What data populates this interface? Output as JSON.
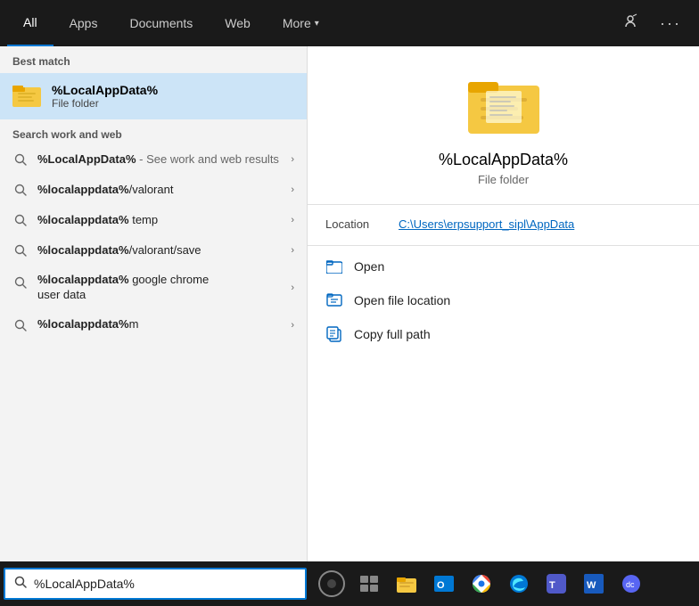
{
  "nav": {
    "tabs": [
      {
        "id": "all",
        "label": "All",
        "active": true
      },
      {
        "id": "apps",
        "label": "Apps",
        "active": false
      },
      {
        "id": "documents",
        "label": "Documents",
        "active": false
      },
      {
        "id": "web",
        "label": "Web",
        "active": false
      },
      {
        "id": "more",
        "label": "More",
        "active": false,
        "has_chevron": true
      }
    ],
    "icons": {
      "user": "👤",
      "ellipsis": "···"
    }
  },
  "best_match": {
    "label": "Best match",
    "title": "%LocalAppData%",
    "subtitle": "File folder"
  },
  "search_section": {
    "label": "Search work and web",
    "items": [
      {
        "text_html": "%LocalAppData% - See work and web results",
        "bold": "%LocalAppData%",
        "rest": " - See work and web results"
      },
      {
        "bold": "%localappdata%",
        "rest": "/valorant"
      },
      {
        "bold": "%localappdata%",
        "rest": " temp"
      },
      {
        "bold": "%localappdata%",
        "rest": "/valorant/save"
      },
      {
        "bold": "%localappdata%",
        "rest": " google chrome user data",
        "multiline": true
      },
      {
        "bold": "%localappdata%",
        "rest": "m"
      }
    ]
  },
  "result_panel": {
    "name": "%LocalAppData%",
    "type": "File folder",
    "location_label": "Location",
    "location_path": "C:\\Users\\erpsupport_sipl\\AppData",
    "actions": [
      {
        "id": "open",
        "label": "Open"
      },
      {
        "id": "open_file_location",
        "label": "Open file location"
      },
      {
        "id": "copy_full_path",
        "label": "Copy full path"
      }
    ]
  },
  "taskbar": {
    "search_text": "%LocalAppData%",
    "search_placeholder": "%LocalAppData%"
  }
}
